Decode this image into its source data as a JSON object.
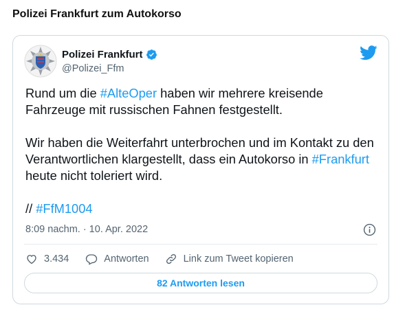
{
  "page": {
    "heading": "Polizei Frankfurt zum Autokorso"
  },
  "tweet": {
    "author_name": "Polizei Frankfurt",
    "author_handle": "@Polizei_Ffm",
    "body": {
      "p1_before": "Rund um die ",
      "p1_hashtag": "#AlteOper",
      "p1_after": " haben wir mehrere kreisende Fahrzeuge mit russischen Fahnen festgestellt.",
      "p2_before": "Wir haben die Weiterfahrt unterbrochen und im Kontakt zu den Verantwortlichen klargestellt, dass ein Autokorso in ",
      "p2_hashtag": "#Frankfurt",
      "p2_after": " heute nicht toleriert wird.",
      "p3_before": "// ",
      "p3_hashtag": "#FfM1004"
    },
    "timestamp": "8:09 nachm. · 10. Apr. 2022",
    "likes_count": "3.434",
    "reply_label": "Antworten",
    "copy_link_label": "Link zum Tweet kopieren",
    "read_replies_label": "82 Antworten lesen"
  },
  "colors": {
    "accent": "#1d9bf0",
    "text": "#0f1419",
    "secondary_text": "#536471",
    "border": "#cfd9de"
  },
  "icons": [
    "police-badge-avatar",
    "verified-badge-icon",
    "twitter-bird-icon",
    "info-icon",
    "heart-icon",
    "reply-bubble-icon",
    "link-icon"
  ]
}
